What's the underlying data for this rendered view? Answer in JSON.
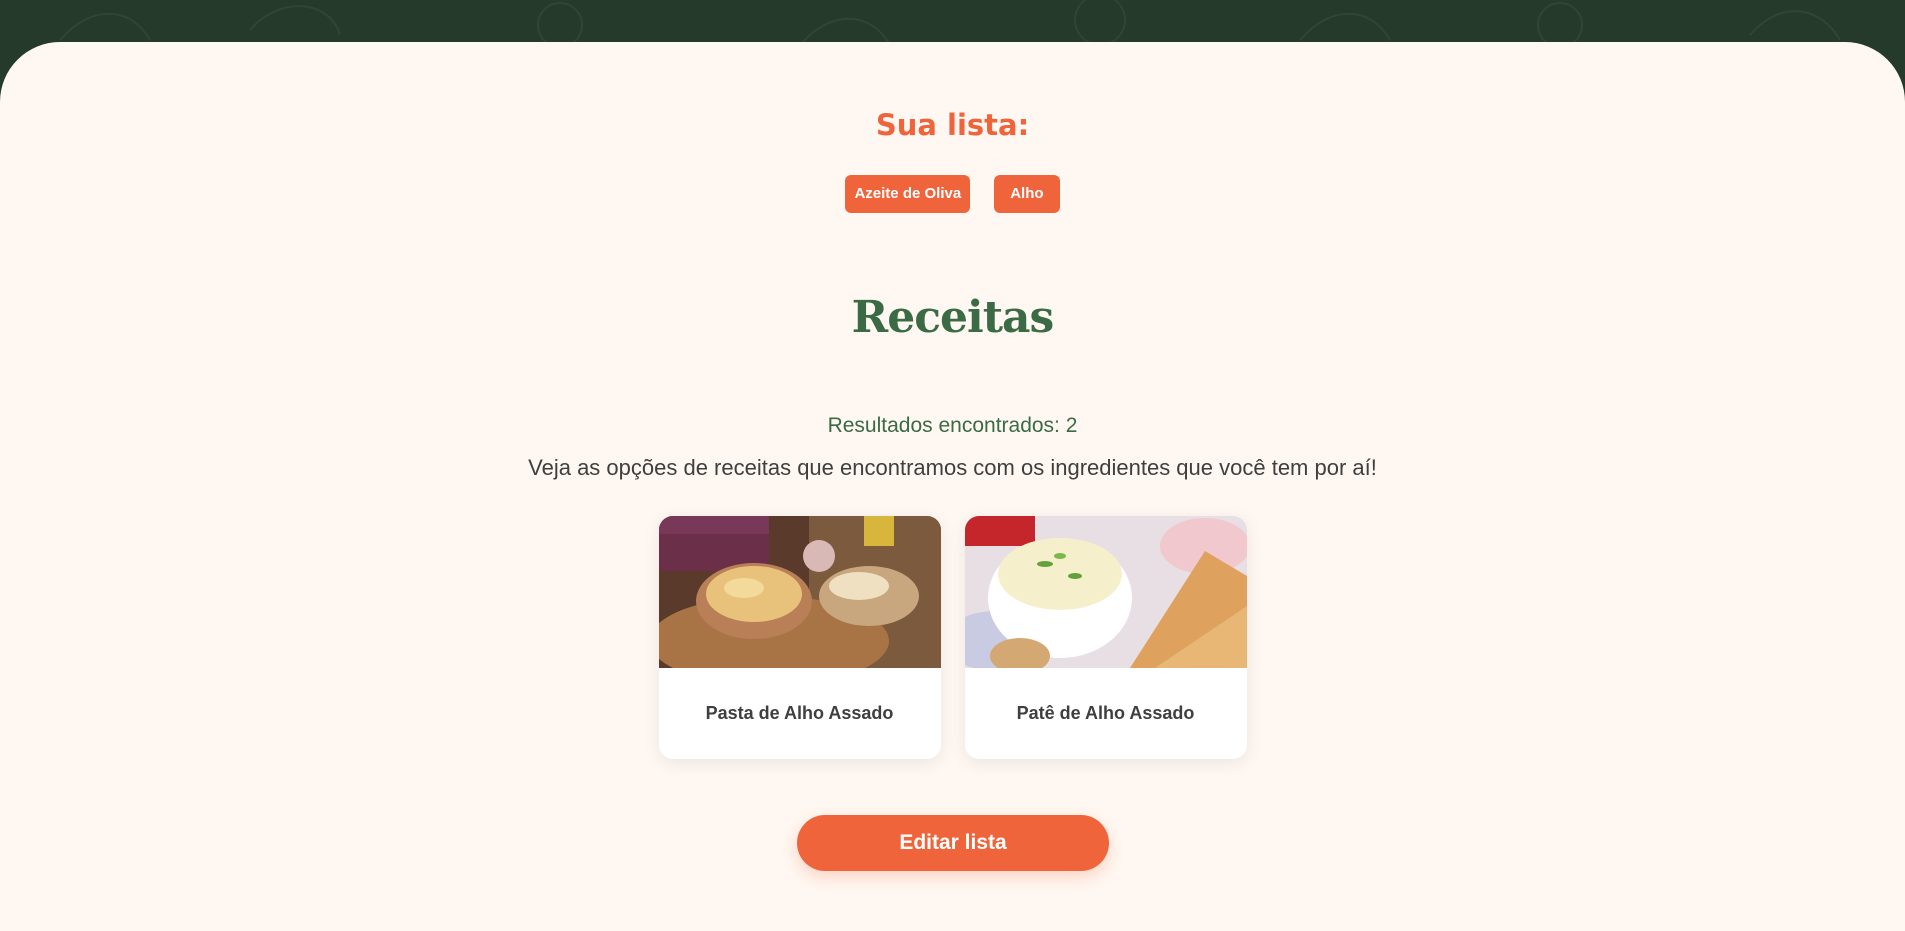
{
  "colors": {
    "header_green": "#253a2a",
    "page_background": "#fff8f2",
    "accent_orange": "#f0643b",
    "title_green": "#3a6b44",
    "body_text": "#3f3f3f"
  },
  "list": {
    "title": "Sua lista:",
    "ingredients": [
      {
        "label": "Azeite de Oliva"
      },
      {
        "label": "Alho"
      }
    ]
  },
  "recipes": {
    "title": "Receitas",
    "results_text": "Resultados encontrados: 2",
    "description": "Veja as opções de receitas que encontramos com os ingredientes que você tem por aí!",
    "items": [
      {
        "name": "Pasta de Alho Assado",
        "image": "roasted garlic spread in bowl on cutting board with bread"
      },
      {
        "name": "Patê de Alho Assado",
        "image": "creamy garlic pate in white bowl with toast"
      }
    ]
  },
  "actions": {
    "edit_label": "Editar lista"
  }
}
